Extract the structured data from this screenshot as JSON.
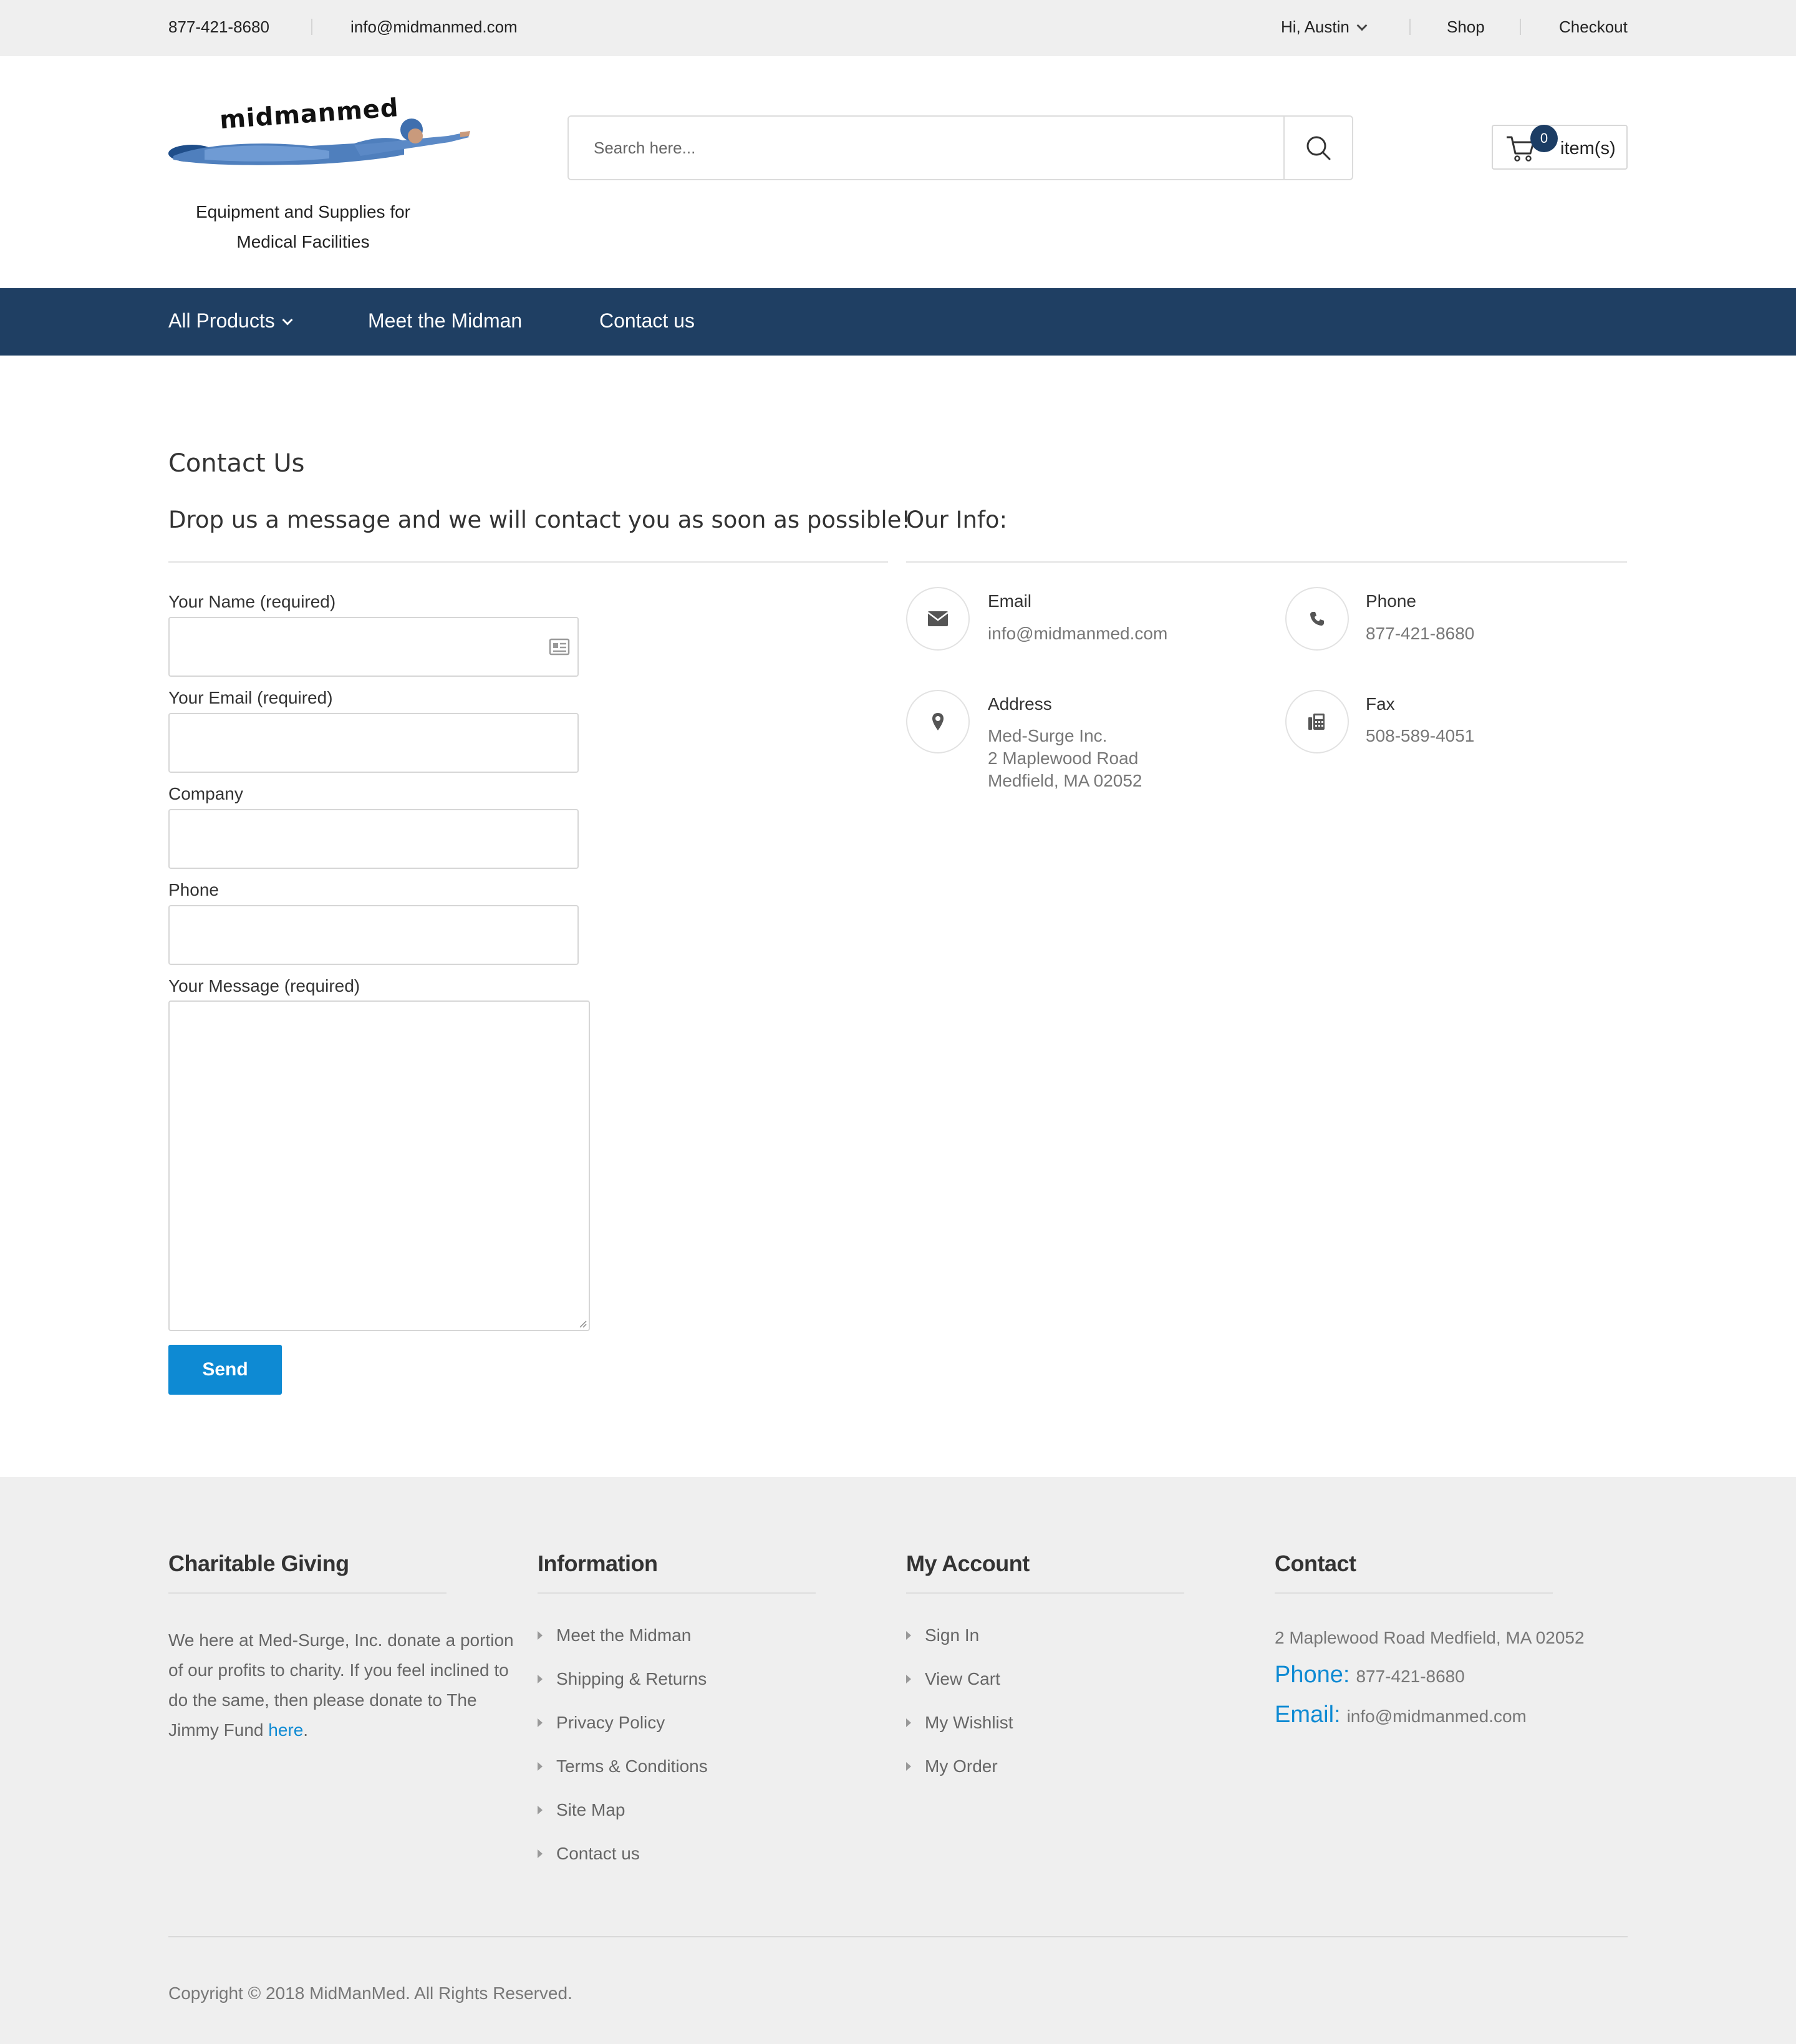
{
  "topbar": {
    "phone": "877-421-8680",
    "email": "info@midmanmed.com",
    "greeting": "Hi, Austin",
    "shop": "Shop",
    "checkout": "Checkout"
  },
  "header": {
    "logo_text": "midmanmed",
    "tagline_line1": "Equipment and Supplies for",
    "tagline_line2": "Medical Facilities",
    "search_placeholder": "Search here...",
    "cart_count": "0",
    "cart_label": "item(s)"
  },
  "nav": {
    "items": [
      "All Products",
      "Meet the Midman",
      "Contact us"
    ]
  },
  "contact": {
    "page_title": "Contact Us",
    "form_heading": "Drop us a message and we will contact you as soon as possible!",
    "info_heading": "Our Info:",
    "fields": {
      "name": "Your Name (required)",
      "email": "Your Email (required)",
      "company": "Company",
      "phone": "Phone",
      "message": "Your Message (required)"
    },
    "send_label": "Send",
    "info": {
      "email_title": "Email",
      "email_value": "info@midmanmed.com",
      "phone_title": "Phone",
      "phone_value": "877-421-8680",
      "address_title": "Address",
      "address_lines": [
        "Med-Surge Inc.",
        "2 Maplewood Road",
        "Medfield, MA 02052"
      ],
      "fax_title": "Fax",
      "fax_value": "508-589-4051"
    }
  },
  "footer": {
    "charitable_title": "Charitable Giving",
    "charitable_text": "We here at Med-Surge, Inc. donate a portion of our profits to charity. If you feel inclined to do the same, then please donate to The Jimmy Fund",
    "charitable_link": "here",
    "charitable_end": ".",
    "information_title": "Information",
    "information_items": [
      "Meet the Midman",
      "Shipping & Returns",
      "Privacy Policy",
      "Terms & Conditions",
      "Site Map",
      "Contact us"
    ],
    "account_title": "My Account",
    "account_items": [
      "Sign In",
      "View Cart",
      "My Wishlist",
      "My Order"
    ],
    "contact_title": "Contact",
    "contact_address": "2 Maplewood Road Medfield, MA 02052",
    "contact_phone_label": "Phone:",
    "contact_phone": "877-421-8680",
    "contact_email_label": "Email:",
    "contact_email": "info@midmanmed.com",
    "copyright": "Copyright © 2018 MidManMed. All Rights Reserved."
  },
  "colors": {
    "nav_bg": "#1f3f63",
    "accent": "#0e8ad3",
    "topbar_bg": "#efefef"
  }
}
